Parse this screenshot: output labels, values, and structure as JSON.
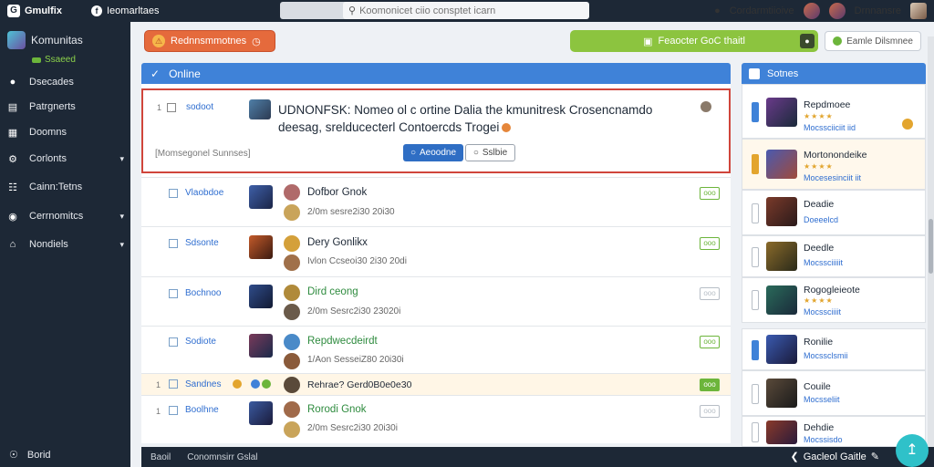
{
  "topbar": {
    "brand": "Gmulfix",
    "link": "Ieomarltaes",
    "search_placeholder": "Koomonicet ciio consptet icarn",
    "user_label": "Cordarmtiioive",
    "user_name": "Drnnansre"
  },
  "sidebar": {
    "title": "Komunitas",
    "subtitle": "Ssaeed",
    "items": [
      {
        "label": "Dsecades",
        "icon": "people-icon"
      },
      {
        "label": "Patrgnerts",
        "icon": "list-icon"
      },
      {
        "label": "Doomns",
        "icon": "grid-icon"
      },
      {
        "label": "Corlonts",
        "icon": "settings-icon",
        "caret": true
      },
      {
        "label": "Cainn:Tetns",
        "icon": "calendar-icon"
      },
      {
        "label": "Cerrnomitcs",
        "icon": "chat-icon",
        "caret": true
      },
      {
        "label": "Nondiels",
        "icon": "home-icon",
        "caret": true
      }
    ],
    "bottom": "Borid"
  },
  "actions": {
    "orange_label": "Rednnsmmotnes",
    "green_label": "Feaocter GoC thaitl",
    "grey_label": "Eamle Dilsmnee"
  },
  "panel": {
    "title": "Online",
    "highlight": {
      "num": "1",
      "name": "sodoot",
      "title": "UDNONFSK: Nomeo ol c ortine Dalia the kmunitresk Crosencnamdo deesag, srelducecterl Contoercds Trogei",
      "sub": "[Momsegonel Sunnses]",
      "primary_btn": "Aeoodne",
      "secondary_btn": "Sslbie"
    },
    "rows": [
      {
        "num": "",
        "name": "Vlaobdoe",
        "title": "Dofbor Gnok",
        "time": "2/0m sesre2i30 20i30",
        "tag": "ooo",
        "tag_style": "green",
        "green_title": false
      },
      {
        "num": "",
        "name": "Sdsonte",
        "title": "Dery Gonlikx",
        "time": "Ivlon Ccseoi30 2i30 20di",
        "tag": "ooo",
        "tag_style": "green",
        "green_title": false
      },
      {
        "num": "",
        "name": "Bochnoo",
        "title": "Dird ceong",
        "time": "2/0m Sesrc2i30 23020i",
        "tag": "ooo",
        "tag_style": "grey",
        "green_title": true
      },
      {
        "num": "",
        "name": "Sodiote",
        "title": "Repdwecdeirdt",
        "time": "1/Aon SesseiZ80 20i30i",
        "tag": "ooo",
        "tag_style": "green",
        "green_title": true
      },
      {
        "num": "1",
        "name": "Sandnes",
        "title": "Rehrae? Gerd0B0e0e30",
        "time": "",
        "tag": "ooo",
        "tag_style": "solid",
        "green_title": false
      },
      {
        "num": "1",
        "name": "Boolhne",
        "title": "Rorodi Gnok",
        "time": "2/0m Sesrc2i30 20i30i",
        "tag": "ooo",
        "tag_style": "grey",
        "green_title": true
      }
    ]
  },
  "right_panel": {
    "title": "Sotnes",
    "cards": [
      {
        "name": "Repdmoee",
        "stars": "★★★★",
        "meta": "Mocssciiciit iid"
      },
      {
        "name": "Mortonondeike",
        "stars": "★★★★",
        "meta": "Mocesesinciit iit"
      },
      {
        "name": "Deadie",
        "stars": "",
        "meta": "Doeeelcd"
      },
      {
        "name": "Deedle",
        "stars": "",
        "meta": "Mocssciiiiit"
      },
      {
        "name": "Rogogleieote",
        "stars": "★★★★",
        "meta": "Mocssciiiit"
      },
      {
        "name": "Ronilie",
        "stars": "",
        "meta": "Mocssclsmii"
      },
      {
        "name": "Couile",
        "stars": "",
        "meta": "Mocsseliit"
      },
      {
        "name": "Dehdie",
        "stars": "",
        "meta": "Mocssisdo"
      }
    ]
  },
  "bottombar": {
    "left": "Baoil",
    "middle": "Conomnsirr Gslal",
    "right": "Gacleol Gaitle"
  },
  "colors": {
    "accent": "#3f82d8",
    "sidebar": "#1d2836",
    "danger": "#d0453b",
    "success": "#6cb53b"
  }
}
